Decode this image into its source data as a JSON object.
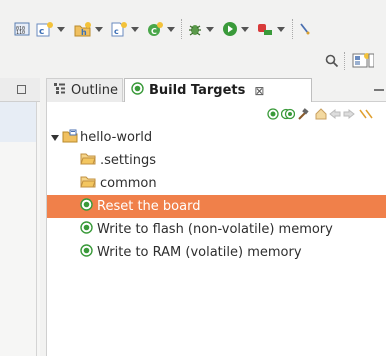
{
  "tabs": {
    "outline": {
      "label": "Outline"
    },
    "build_targets": {
      "label": "Build Targets",
      "close": "⊠"
    }
  },
  "tree": {
    "project": {
      "label": "hello-world"
    },
    "folders": [
      {
        "label": ".settings"
      },
      {
        "label": "common"
      }
    ],
    "targets": [
      {
        "label": "Reset the board",
        "selected": true
      },
      {
        "label": "Write to flash (non-volatile) memory",
        "selected": false
      },
      {
        "label": "Write to RAM (volatile) memory",
        "selected": false
      }
    ]
  },
  "colors": {
    "selection": "#f0804a",
    "target_green": "#3a9a3a",
    "folder_orange": "#e8a23a"
  },
  "icons": {
    "search": "search-icon",
    "perspective": "open-perspective-icon",
    "outline": "outline-icon",
    "build_target": "build-target-icon",
    "project": "project-folder-icon",
    "folder": "folder-icon"
  }
}
